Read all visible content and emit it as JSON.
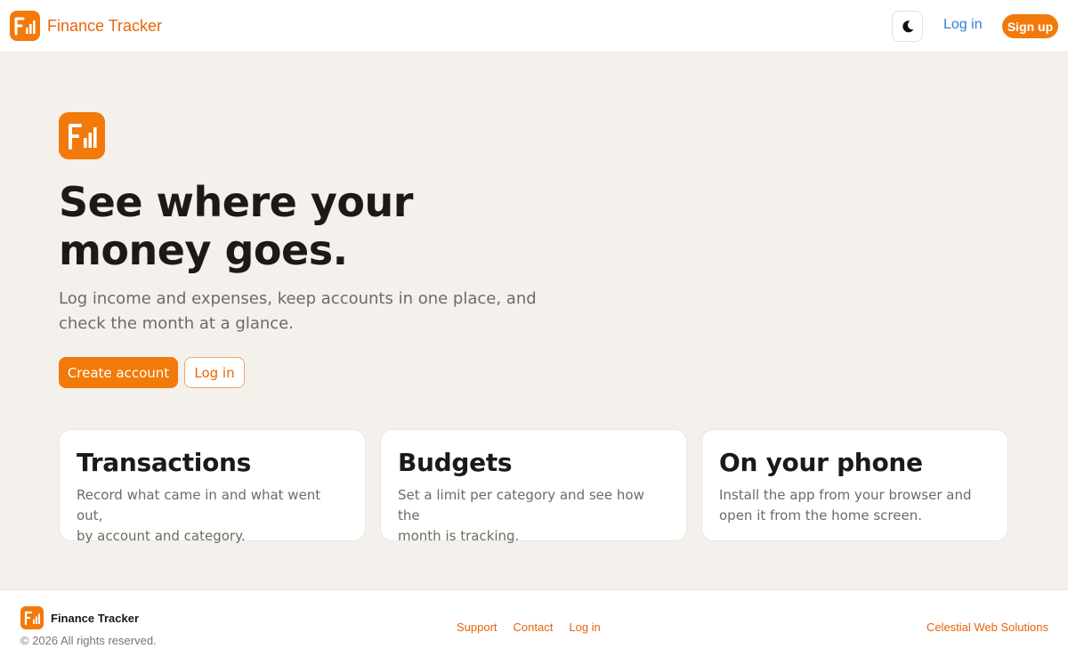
{
  "colors": {
    "accent": "#f27a0a",
    "accent_text": "#e8650a",
    "link_blue": "#2f7fd6",
    "page_bg": "#f4f1ec",
    "muted_text": "#6f6a64"
  },
  "header": {
    "brand_name": "Finance Tracker",
    "logo_icon": "finance-tracker-logo-icon",
    "theme_toggle_icon": "moon-icon",
    "login_label": "Log in",
    "signup_label": "Sign up"
  },
  "hero": {
    "logo_icon": "finance-tracker-logo-icon",
    "title_line1": "See where your",
    "title_line2": "money goes.",
    "subtitle_line1": "Log income and expenses, keep accounts in one place, and",
    "subtitle_line2": "check the month at a glance.",
    "primary_button": "Create account",
    "secondary_button": "Log in"
  },
  "features": [
    {
      "title": "Transactions",
      "body_line1": "Record what came in and what went out,",
      "body_line2": "by account and category."
    },
    {
      "title": "Budgets",
      "body_line1": "Set a limit per category and see how the",
      "body_line2": "month is tracking."
    },
    {
      "title": "On your phone",
      "body_line1": "Install the app from your browser and",
      "body_line2": "open it from the home screen."
    }
  ],
  "footer": {
    "brand_name": "Finance Tracker",
    "copyright": "© 2026 All rights reserved.",
    "links": [
      "Support",
      "Contact",
      "Log in"
    ],
    "company": "Celestial Web Solutions"
  }
}
